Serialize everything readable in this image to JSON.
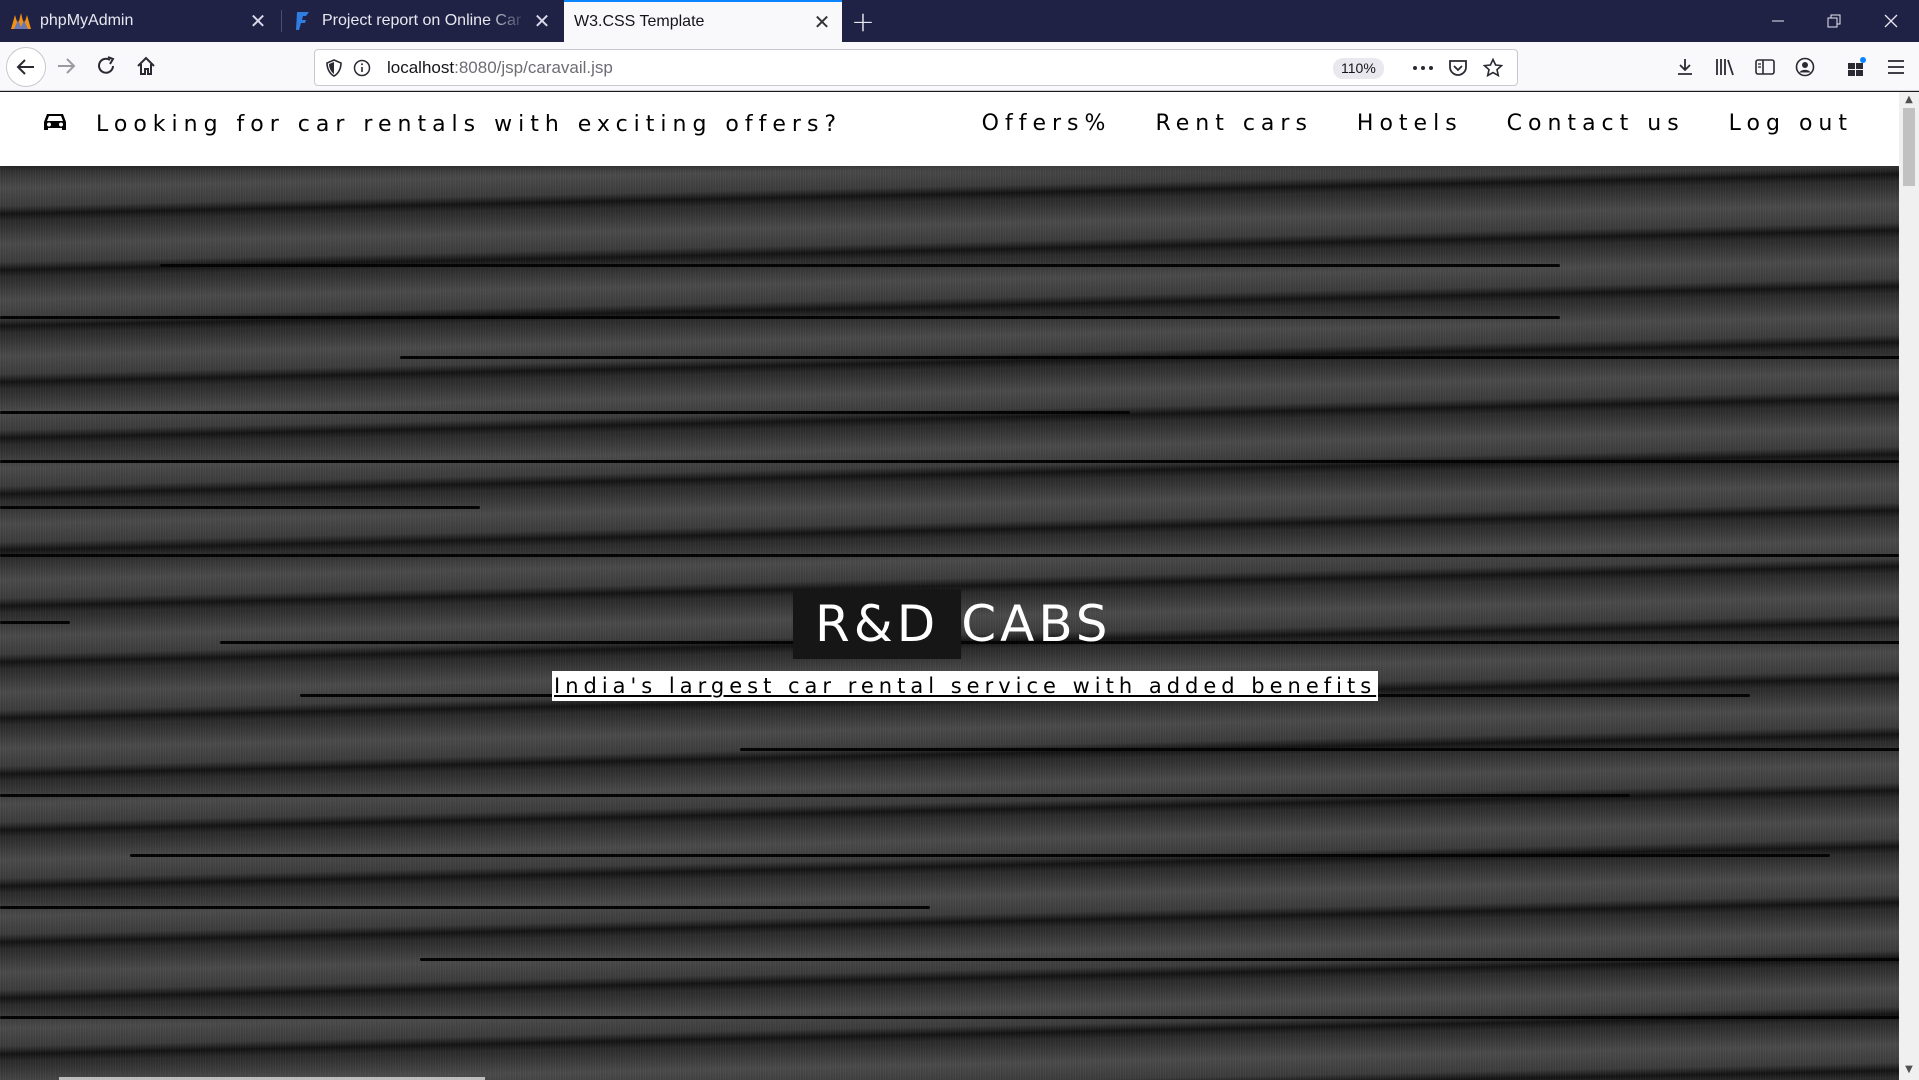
{
  "browser": {
    "tabs": [
      {
        "title": "phpMyAdmin",
        "icon": "phpmyadmin-icon",
        "active": false
      },
      {
        "title": "Project report on Online Car Re",
        "icon": "document-icon",
        "active": false
      },
      {
        "title": "W3.CSS Template",
        "icon": "",
        "active": true
      }
    ],
    "url": {
      "host": "localhost",
      "path": ":8080/jsp/caravail.jsp"
    },
    "zoom": "110%"
  },
  "site": {
    "brand": {
      "icon": "car-icon",
      "tagline": "Looking for car rentals with exciting offers?"
    },
    "menu": [
      "Offers%",
      "Rent cars",
      "Hotels",
      "Contact us",
      "Log out"
    ]
  },
  "hero": {
    "title_first": "R&D",
    "title_second": "CABS",
    "subtitle": "India's largest car rental service with added benefits"
  },
  "colors": {
    "tabbar": "#1f2145",
    "active_tab_accent": "#0a84ff",
    "hero_dark": "#2f2f2f"
  }
}
